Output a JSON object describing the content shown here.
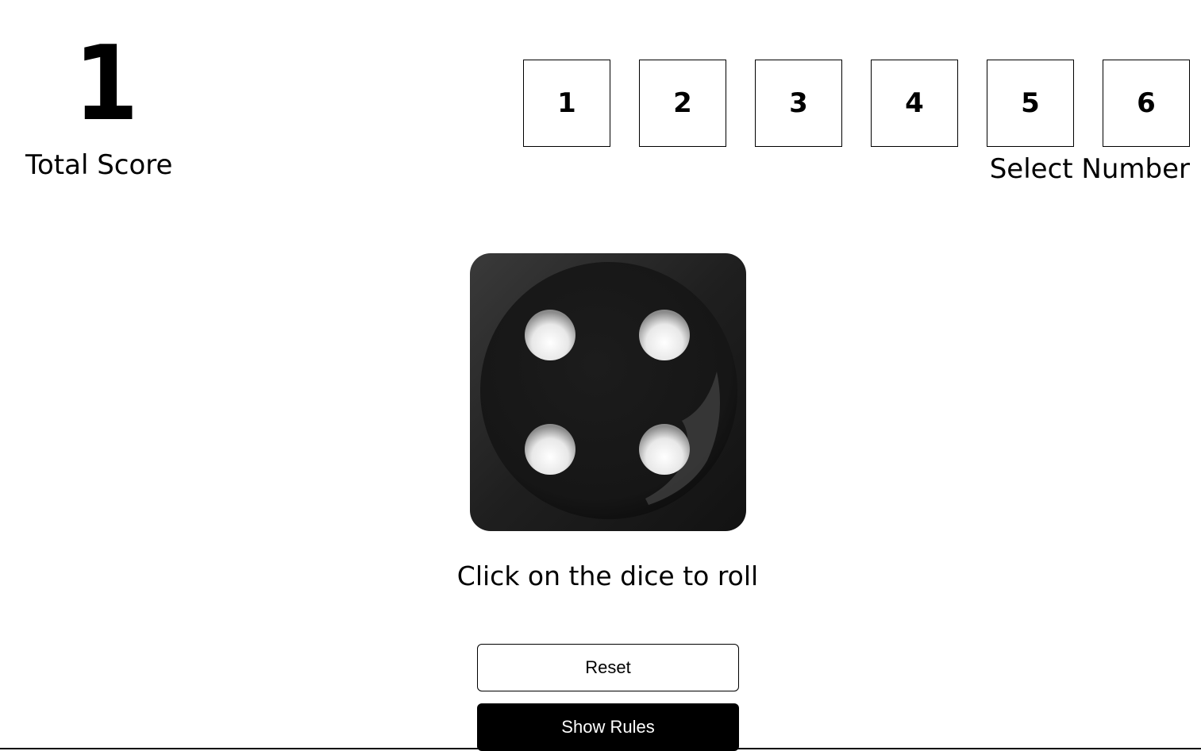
{
  "score": {
    "value": "1",
    "label": "Total Score"
  },
  "number_select": {
    "options": [
      "1",
      "2",
      "3",
      "4",
      "5",
      "6"
    ],
    "label": "Select Number"
  },
  "dice": {
    "face_value": 4,
    "hint": "Click on the dice to roll"
  },
  "buttons": {
    "reset_label": "Reset",
    "rules_label": "Show Rules"
  },
  "colors": {
    "background": "#ffffff",
    "text": "#000000",
    "dice_body": "#1e1e1e",
    "dice_pip": "#f2f2f2",
    "rules_button_bg": "#000000",
    "rules_button_text": "#ffffff"
  }
}
